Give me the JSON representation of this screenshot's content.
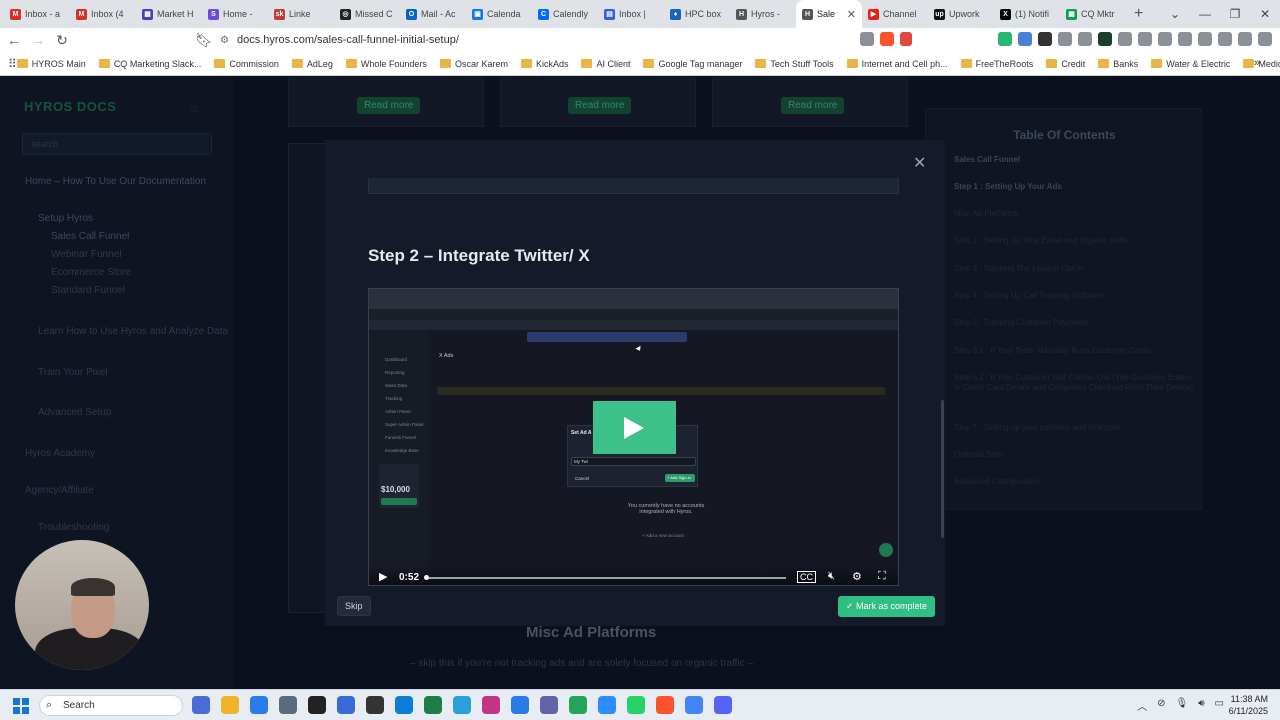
{
  "browser": {
    "tabs": [
      {
        "label": "Inbox - a",
        "fav": "M",
        "color": "#d93025"
      },
      {
        "label": "Inbox (4",
        "fav": "M",
        "color": "#d93025"
      },
      {
        "label": "Market H",
        "fav": "▦",
        "color": "#4a3fb5"
      },
      {
        "label": "Home - ",
        "fav": "S",
        "color": "#6b4bd8"
      },
      {
        "label": "Linke",
        "fav": "sk",
        "color": "#c23b3b"
      },
      {
        "label": "Missed C",
        "fav": "◎",
        "color": "#222"
      },
      {
        "label": "Mail - Ac",
        "fav": "O",
        "color": "#0a64c8"
      },
      {
        "label": "Calenda",
        "fav": "▣",
        "color": "#1a73e8"
      },
      {
        "label": "Calendly",
        "fav": "C",
        "color": "#006bff"
      },
      {
        "label": "Inbox | ",
        "fav": "▤",
        "color": "#3b5fd9"
      },
      {
        "label": "HPC box",
        "fav": "♦",
        "color": "#1565c0"
      },
      {
        "label": "Hyros - ",
        "fav": "H",
        "color": "#555"
      },
      {
        "label": "Sale",
        "fav": "H",
        "color": "#555",
        "active": true
      },
      {
        "label": "Channel",
        "fav": "▶",
        "color": "#e62117"
      },
      {
        "label": "Upwork",
        "fav": "up",
        "color": "#111"
      },
      {
        "label": "(1) Notifi",
        "fav": "X",
        "color": "#000"
      },
      {
        "label": "CQ Mktr",
        "fav": "▦",
        "color": "#0f9d58"
      }
    ],
    "url": "docs.hyros.com/sales-call-funnel-initial-setup/",
    "bookmarks": [
      "HYROS Main",
      "CQ Marketing Slack...",
      "Commission",
      "AdLeg",
      "Whole Founders",
      "Oscar Karem",
      "KickAds",
      "AI Client",
      "Google Tag manager",
      "Tech Stuff Tools",
      "Internet and Cell ph...",
      "FreeTheRoots",
      "Credit",
      "Banks",
      "Water & Electric",
      "Medical"
    ]
  },
  "sidebar": {
    "logo": "HYROS DOCS",
    "search_placeholder": "search",
    "items": [
      "Home – How To Use Our Documentation",
      "Setup Hyros",
      "Sales Call Funnel",
      "Webinar Funnel",
      "Ecommerce Store",
      "Standard Funnel",
      "Learn How to Use Hyros and Analyze Data",
      "Train Your Pixel",
      "Advanced Setup",
      "Hyros Academy",
      "Agency/Affiliate",
      "Troubleshooting"
    ]
  },
  "page": {
    "read_more": "Read more",
    "below_title": "Misc Ad Platforms",
    "below_sub": "– skip this if you're not tracking ads and are solely focused on organic traffic –"
  },
  "toc": {
    "title": "Table Of Contents",
    "items": [
      "Sales Call Funnel",
      "Step 1 : Setting Up Your Ads",
      "Misc Ad Platforms",
      "Step 2 : Setting Up Your Email and Organic traffic",
      "Step 3 : Tracking The Lead or Opt In",
      "Step 4 : Setting Up Call Tracking Software",
      "Step 6 : Tracking Customer Payments",
      "Step 6.1 : If Your Team Manually Runs Customer Cards",
      "Step 6.2 : If Your Customer Self Checks Out (The Customer Enters In Credit Card Details and Completes Checkout From Their Device)",
      "Step 5 : Setting up your currency and timezone",
      "Optional Step",
      "Advanced Configuration"
    ]
  },
  "modal": {
    "title": "Step 2 – Integrate Twitter/ X",
    "skip": "Skip",
    "complete": "✓ Mark as complete",
    "video": {
      "time": "0:52",
      "progress": 0.0,
      "inner_heading": "X Ads",
      "inner_dialog_title": "Set Ad A",
      "inner_input_value": "My Twi",
      "inner_cancel": "Cancel",
      "inner_add": "+ Add Sign-in",
      "inner_empty": "You currently have no accounts integrated with Hyros.",
      "inner_add_new": "+ Add a new account",
      "inner_menu": [
        "Dashboard",
        "Reporting",
        "Sales Data",
        "Tracking",
        "Admin Panel",
        "Super Admin Panel",
        "Funnels Funnel",
        "Knowledge Base"
      ],
      "inner_promo_value": "$10,000"
    }
  },
  "taskbar": {
    "search": "Search",
    "time": "11:38 AM",
    "date": "6/11/2025",
    "app_colors": [
      "#4a6cd4",
      "#f0b429",
      "#2b7de9",
      "#5b6b7c",
      "#222",
      "#3a6ad8",
      "#333",
      "#0c7dd4",
      "#1e7e45",
      "#2a9fd9",
      "#c13584",
      "#2a7be4",
      "#6264a7",
      "#25a35a",
      "#2d8cff",
      "#25d366",
      "#fb542b",
      "#4285f4",
      "#5865f2"
    ]
  }
}
